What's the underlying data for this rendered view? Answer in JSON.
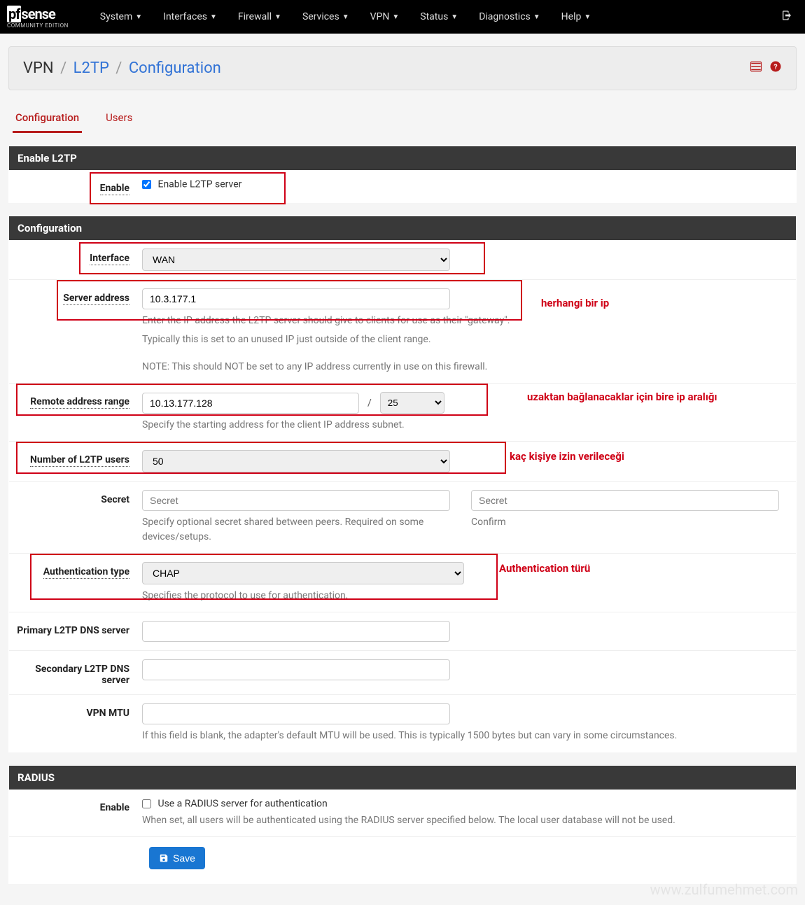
{
  "nav": {
    "logo_main_pf": "pf",
    "logo_main_sense": "sense",
    "logo_sub": "COMMUNITY EDITION",
    "items": [
      "System",
      "Interfaces",
      "Firewall",
      "Services",
      "VPN",
      "Status",
      "Diagnostics",
      "Help"
    ]
  },
  "breadcrumb": {
    "part1": "VPN",
    "part2": "L2TP",
    "part3": "Configuration"
  },
  "tabs": [
    "Configuration",
    "Users"
  ],
  "panels": {
    "enable_l2tp": {
      "title": "Enable L2TP",
      "enable_label": "Enable",
      "enable_checkbox": "Enable L2TP server"
    },
    "configuration": {
      "title": "Configuration",
      "interface_label": "Interface",
      "interface_value": "WAN",
      "server_address_label": "Server address",
      "server_address_value": "10.3.177.1",
      "server_address_help1": "Enter the IP address the L2TP server should give to clients for use as their \"gateway\".",
      "server_address_help2": "Typically this is set to an unused IP just outside of the client range.",
      "server_address_help3": "NOTE: This should NOT be set to any IP address currently in use on this firewall.",
      "remote_range_label": "Remote address range",
      "remote_range_value": "10.13.177.128",
      "remote_range_mask": "25",
      "remote_range_help": "Specify the starting address for the client IP address subnet.",
      "num_users_label": "Number of L2TP users",
      "num_users_value": "50",
      "secret_label": "Secret",
      "secret_placeholder": "Secret",
      "secret_help": "Specify optional secret shared between peers. Required on some devices/setups.",
      "secret_confirm_placeholder": "Secret",
      "secret_confirm_help": "Confirm",
      "auth_type_label": "Authentication type",
      "auth_type_value": "CHAP",
      "auth_type_help": "Specifies the protocol to use for authentication.",
      "primary_dns_label": "Primary L2TP DNS server",
      "secondary_dns_label": "Secondary L2TP DNS server",
      "vpn_mtu_label": "VPN MTU",
      "vpn_mtu_help": "If this field is blank, the adapter's default MTU will be used. This is typically 1500 bytes but can vary in some circumstances."
    },
    "radius": {
      "title": "RADIUS",
      "enable_label": "Enable",
      "enable_checkbox": "Use a RADIUS server for authentication",
      "enable_help": "When set, all users will be authenticated using the RADIUS server specified below. The local user database will not be used."
    }
  },
  "save_button": "Save",
  "annotations": {
    "a1": "herhangi bir ip",
    "a2": "uzaktan bağlanacaklar için bire ip aralığı",
    "a3": "kaç kişiye izin verileceği",
    "a4": "Authentication türü"
  },
  "watermark": "www.zulfumehmet.com"
}
